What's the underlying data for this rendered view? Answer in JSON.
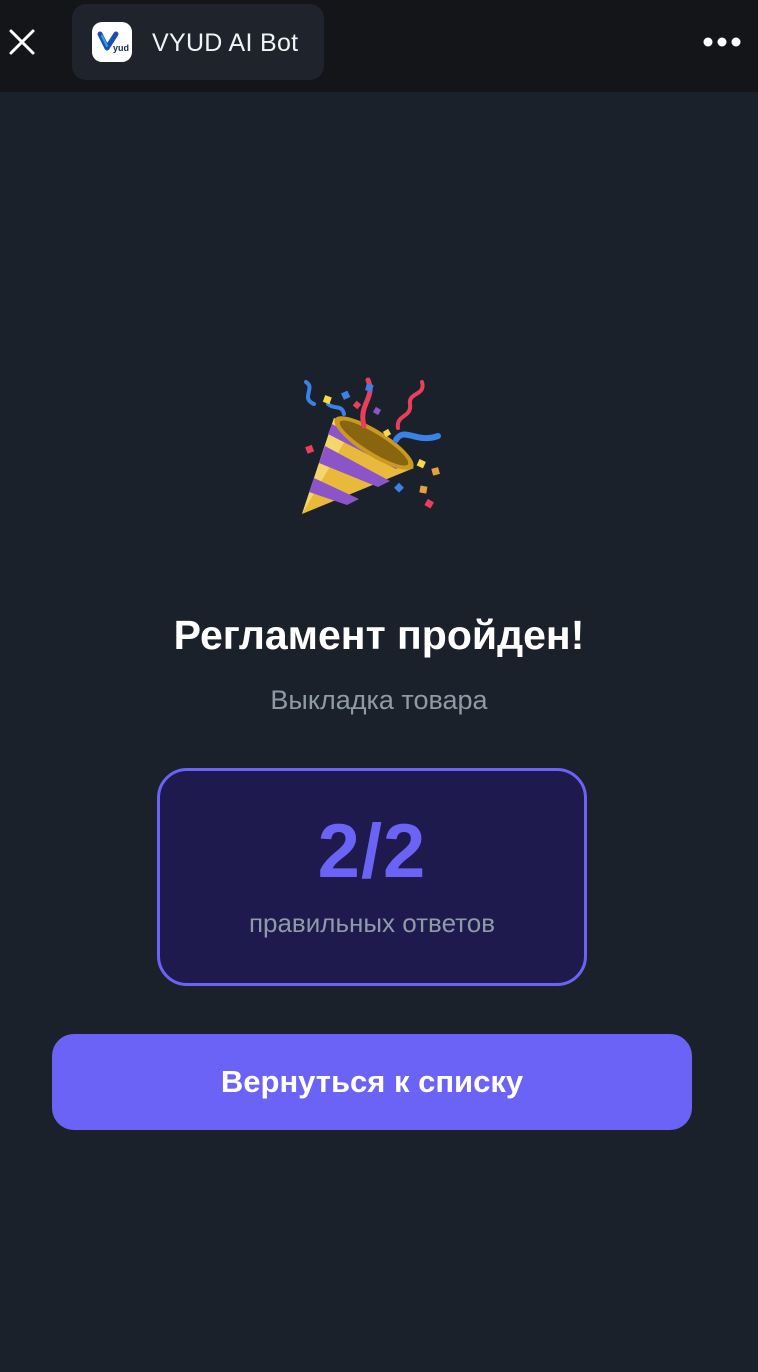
{
  "header": {
    "bot_name": "VYUD AI Bot",
    "logo_text": "yud",
    "icons": {
      "close": "close-icon",
      "more": "more-dots-icon",
      "logo": "vyud-logo-icon"
    }
  },
  "result": {
    "emoji_icon": "party-popper-icon",
    "title": "Регламент пройден!",
    "subtitle": "Выкладка товара",
    "score": "2/2",
    "score_label": "правильных ответов"
  },
  "actions": {
    "back_label": "Вернуться к списку"
  },
  "colors": {
    "background": "#1b212a",
    "topbar": "#131519",
    "accent": "#6b63f5",
    "card_bg": "#1e1a4d",
    "muted_text": "#8f9aa7"
  }
}
